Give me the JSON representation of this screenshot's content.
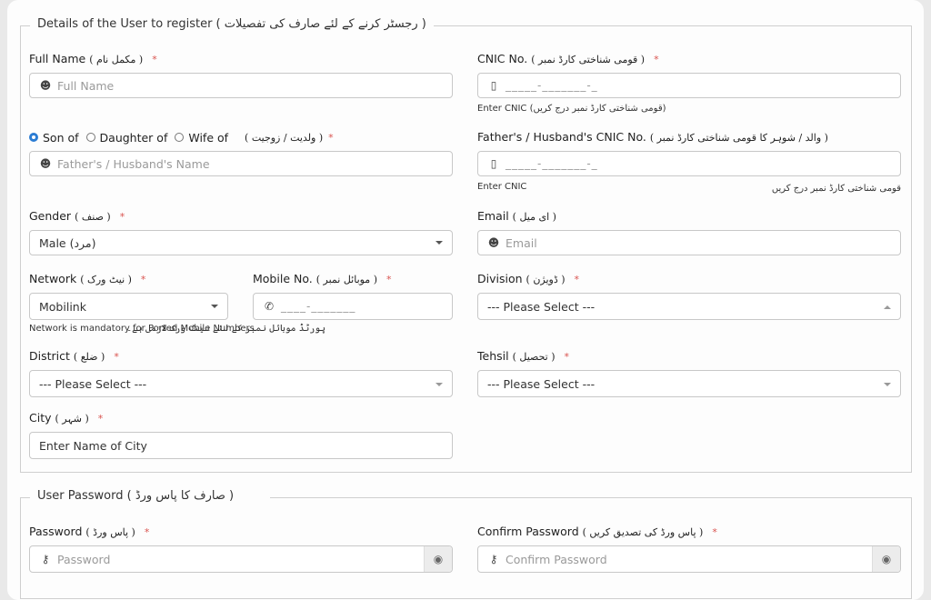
{
  "details_section": {
    "legend": "Details of the User to register ( رجسٹر کرنے کے لئے صارف کی تفصیلات )",
    "full_name": {
      "label": "Full Name",
      "label_ur": "( مکمل نام )",
      "required": "*",
      "placeholder": "Full Name",
      "icon": "user-icon"
    },
    "cnic": {
      "label": "CNIC No.",
      "label_ur": "( قومی شناختی کارڈ نمبر )",
      "required": "*",
      "mask": "_____-_______-_",
      "icon": "document-icon",
      "hint": "Enter CNIC (قومی شناختی کارڈ نمبر درج کریں)"
    },
    "relation": {
      "options": [
        {
          "label": "Son of",
          "selected": true
        },
        {
          "label": "Daughter of",
          "selected": false
        },
        {
          "label": "Wife of",
          "selected": false
        }
      ],
      "label_ur": "( ولدیت / زوجیت )",
      "required": "*",
      "placeholder": "Father's / Husband's Name",
      "icon": "user-icon"
    },
    "father_cnic": {
      "label": "Father's / Husband's CNIC No.",
      "label_ur": "( والد / شوہر کا قومی شناختی کارڈ نمبر )",
      "mask": "_____-_______-_",
      "icon": "document-icon",
      "hint": "Enter CNIC",
      "hint_ur": "قومی شناختی کارڈ نمبر درج کریں"
    },
    "gender": {
      "label": "Gender",
      "label_ur": "( صنف )",
      "required": "*",
      "value": "Male (مرد)"
    },
    "email": {
      "label": "Email",
      "label_ur": "( ای میل )",
      "placeholder": "Email",
      "icon": "user-icon"
    },
    "network": {
      "label": "Network",
      "label_ur": "( نیٹ ورک )",
      "required": "*",
      "value": "Mobilink",
      "hint": "Network is mandatory for Ported Mobile Numbers."
    },
    "mobile": {
      "label": "Mobile No.",
      "label_ur": "( موبائل نمبر )",
      "required": "*",
      "mask": "____-_______",
      "icon": "phone-icon",
      "hint_ur": "پورٹڈ موبائل نمبر کے لئے نیٹ ورک لازمی ہے۔"
    },
    "division": {
      "label": "Division",
      "label_ur": "( ڈویژن )",
      "required": "*",
      "placeholder": "--- Please Select ---"
    },
    "district": {
      "label": "District",
      "label_ur": "( ضلع )",
      "required": "*",
      "placeholder": "--- Please Select ---"
    },
    "tehsil": {
      "label": "Tehsil",
      "label_ur": "( تحصیل )",
      "required": "*",
      "placeholder": "--- Please Select ---"
    },
    "city": {
      "label": "City",
      "label_ur": "( شہر )",
      "required": "*",
      "placeholder": "Enter Name of City"
    }
  },
  "password_section": {
    "legend": "User Password ( صارف کا پاس ورڈ )",
    "password": {
      "label": "Password",
      "label_ur": "( پاس ورڈ )",
      "required": "*",
      "placeholder": "Password",
      "icon": "key-icon",
      "toggle_icon": "eye-icon"
    },
    "confirm": {
      "label": "Confirm Password",
      "label_ur": "( پاس ورڈ کی تصدیق کریں )",
      "required": "*",
      "placeholder": "Confirm Password",
      "icon": "key-icon",
      "toggle_icon": "eye-icon"
    }
  }
}
